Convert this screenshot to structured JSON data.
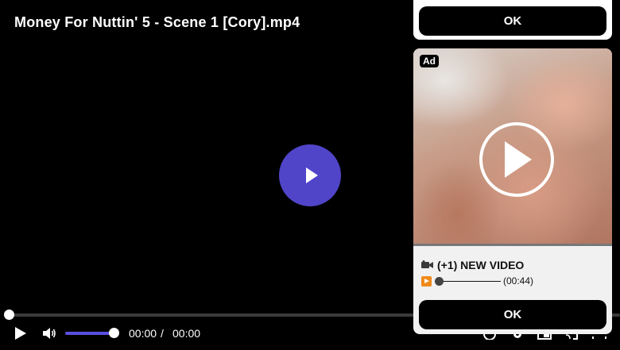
{
  "video": {
    "title": "Money For Nuttin' 5 - Scene 1 [Cory].mp4",
    "progress_fraction": 0.0,
    "volume_fraction": 1.0
  },
  "controls": {
    "current_time": "00:00",
    "separator": "/",
    "total_time": "00:00"
  },
  "ad": {
    "top_ok_label": "OK",
    "badge": "Ad",
    "headline_icon": "video-camera-icon",
    "headline": "(+1) NEW VIDEO",
    "duration": "(00:44)",
    "ok_label": "OK"
  },
  "colors": {
    "accent": "#5045c8",
    "volume_fill": "#5b4fe0",
    "background": "#000000"
  }
}
